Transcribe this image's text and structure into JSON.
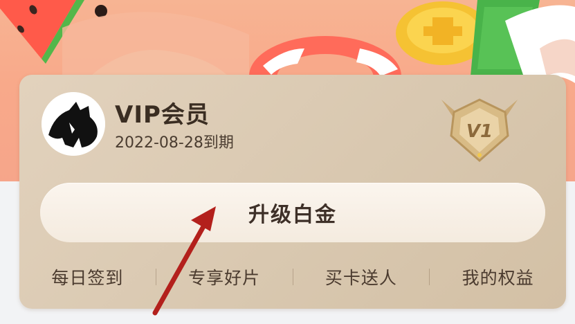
{
  "membership": {
    "title": "VIP会员",
    "expiry": "2022-08-28到期",
    "level_badge": "V1"
  },
  "upgrade_button": {
    "label": "升级白金"
  },
  "quick_actions": [
    {
      "label": "每日签到"
    },
    {
      "label": "专享好片"
    },
    {
      "label": "买卡送人"
    },
    {
      "label": "我的权益"
    }
  ],
  "colors": {
    "banner": "#f8a98a",
    "card": "#d9c8b0",
    "button": "#f8f1e8",
    "annotation_arrow": "#b3201c"
  },
  "icons": [
    "avatar-cat-silhouette",
    "v1-shield-badge-icon",
    "annotation-arrow"
  ]
}
